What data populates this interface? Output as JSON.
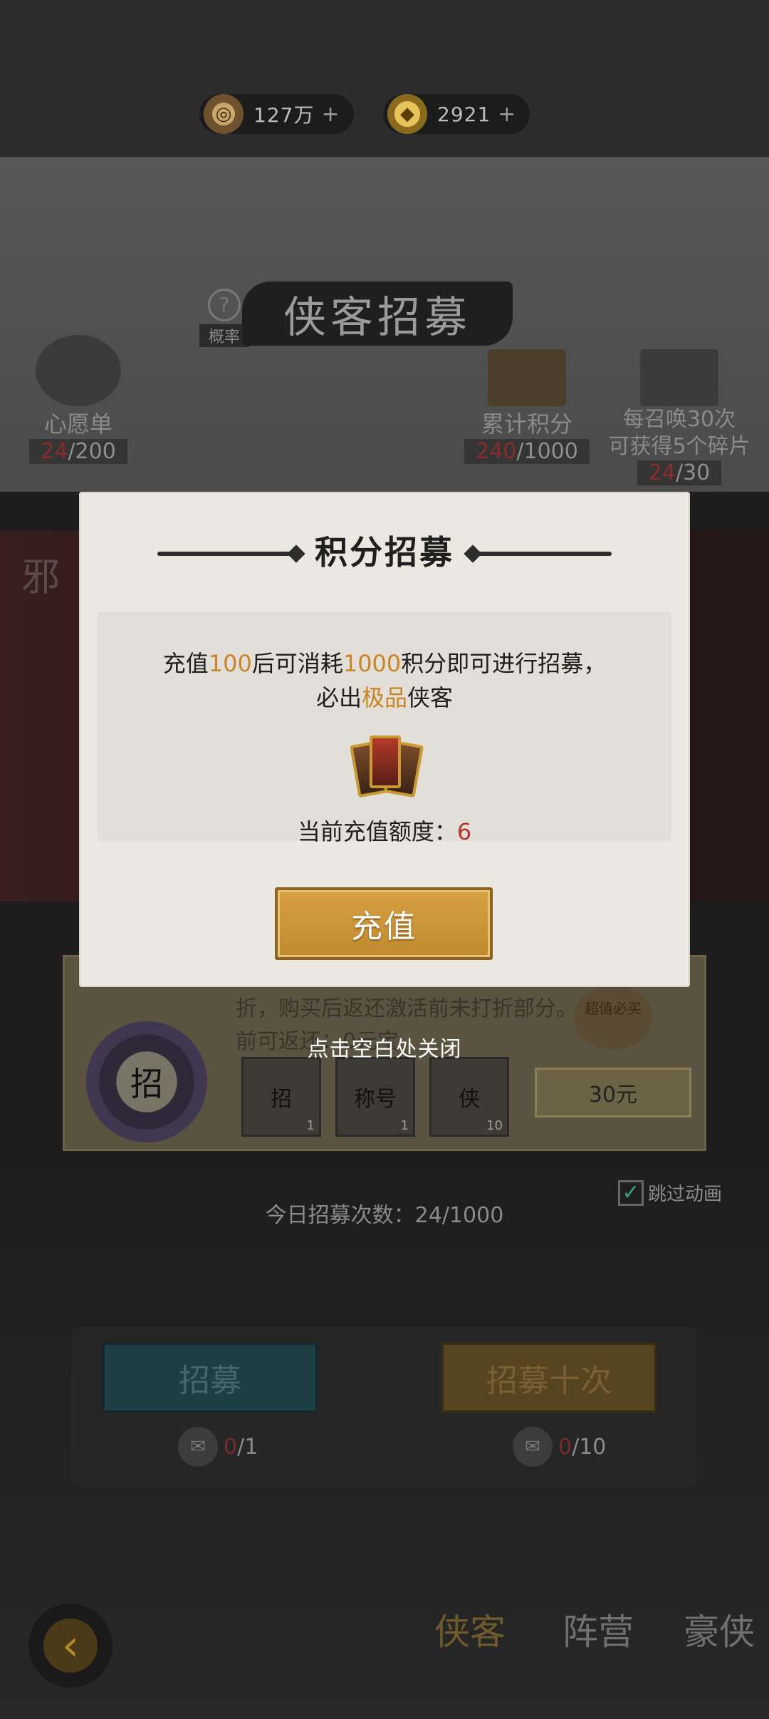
{
  "currencies": [
    {
      "icon": "copper-coin-icon",
      "value": "127万"
    },
    {
      "icon": "gold-ingot-icon",
      "value": "2921"
    }
  ],
  "header": {
    "title": "侠客招募",
    "probability_label": "概率",
    "wishlist": {
      "label": "心愿单",
      "current": "24",
      "total": "/200"
    },
    "points": {
      "label": "累计积分",
      "current": "240",
      "total": "/1000"
    },
    "shards": {
      "line1": "每召唤30次",
      "line2": "可获得5个碎片",
      "current": "24",
      "total": "/30"
    }
  },
  "banner": {
    "side_char": "邪",
    "offer_text": "折，购买后返还激活前未打折部分。当前可返还：0元宝",
    "seal": "招",
    "items": [
      {
        "label": "招",
        "qty": "1"
      },
      {
        "label": "称号",
        "qty": "1"
      },
      {
        "label": "侠",
        "qty": "10"
      }
    ],
    "price": "30元",
    "deal_badge": "超值必买"
  },
  "today": "今日招募次数：24/1000",
  "skip_animation": "跳过动画",
  "recruit": {
    "single_label": "招募",
    "single_cost_current": "0",
    "single_cost_total": "/1",
    "ten_label": "招募十次",
    "ten_cost_current": "0",
    "ten_cost_total": "/10"
  },
  "bottom_tabs": [
    "侠客",
    "阵营",
    "豪侠"
  ],
  "dialog": {
    "title": "积分招募",
    "desc_part1": "充值",
    "desc_amount": "100",
    "desc_part2": "后可消耗",
    "desc_points": "1000",
    "desc_part3": "积分即可进行招募，",
    "desc_line2_part1": "必出",
    "desc_quality": "极品",
    "desc_line2_part2": "侠客",
    "credit_label": "当前充值额度：",
    "credit_value": "6",
    "recharge_button": "充值"
  },
  "close_hint": "点击空白处关闭",
  "colors": {
    "highlight": "#c98424",
    "credit_value": "#b8352e",
    "recharge_button": "#d7a043"
  }
}
